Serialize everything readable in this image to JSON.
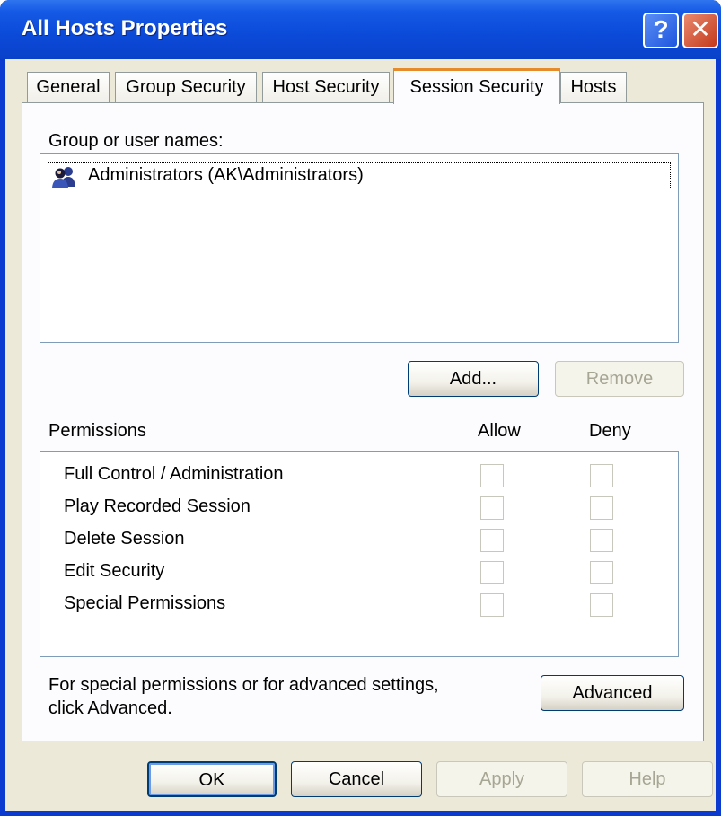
{
  "window": {
    "title": "All Hosts Properties",
    "help_glyph": "?",
    "close_glyph": "✕"
  },
  "tabs": [
    {
      "label": "General",
      "active": false
    },
    {
      "label": "Group Security",
      "active": false
    },
    {
      "label": "Host Security",
      "active": false
    },
    {
      "label": "Session Security",
      "active": true
    },
    {
      "label": "Hosts",
      "active": false
    }
  ],
  "users": {
    "label": "Group or user names:",
    "items": [
      {
        "icon": "user-group-icon",
        "name": "Administrators (AK\\Administrators)",
        "selected": true
      }
    ],
    "add_label": "Add...",
    "remove_label": "Remove"
  },
  "permissions": {
    "header": "Permissions",
    "allow_header": "Allow",
    "deny_header": "Deny",
    "rows": [
      {
        "label": "Full Control / Administration",
        "allow": false,
        "deny": false
      },
      {
        "label": "Play Recorded Session",
        "allow": false,
        "deny": false
      },
      {
        "label": "Delete Session",
        "allow": false,
        "deny": false
      },
      {
        "label": "Edit Security",
        "allow": false,
        "deny": false
      },
      {
        "label": "Special Permissions",
        "allow": false,
        "deny": false
      }
    ]
  },
  "advanced": {
    "text_line1": "For special permissions or for advanced settings,",
    "text_line2": "click Advanced.",
    "button_label": "Advanced"
  },
  "footer": {
    "ok_label": "OK",
    "cancel_label": "Cancel",
    "apply_label": "Apply",
    "help_label": "Help"
  },
  "colors": {
    "titlebar": "#0b4ad8",
    "dialog_bg": "#ece9d8",
    "active_tab_accent": "#e68b2c",
    "disabled_text": "#a7a694"
  }
}
